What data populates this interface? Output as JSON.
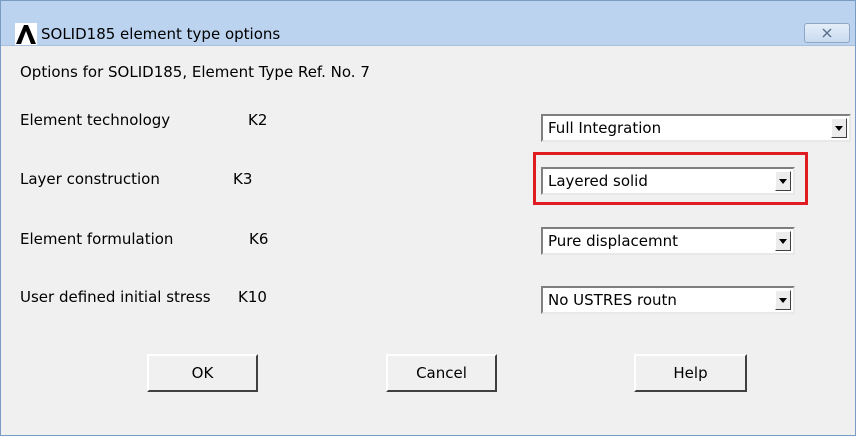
{
  "window": {
    "title": "SOLID185 element type options",
    "app_icon": "ansys-logo-icon",
    "close_icon": "close-icon"
  },
  "header": {
    "text": "Options for SOLID185, Element Type Ref. No. 7"
  },
  "options": [
    {
      "label": "Element technology",
      "key": "K2",
      "value": "Full Integration"
    },
    {
      "label": "Layer construction",
      "key": "K3",
      "value": "Layered solid"
    },
    {
      "label": "Element formulation",
      "key": "K6",
      "value": "Pure displacemnt"
    },
    {
      "label": "User defined initial stress",
      "key": "K10",
      "value": "No USTRES routn"
    }
  ],
  "buttons": {
    "ok": "OK",
    "cancel": "Cancel",
    "help": "Help"
  },
  "colors": {
    "highlight": "#e11b22",
    "titlebar": "#bcd3ef"
  }
}
